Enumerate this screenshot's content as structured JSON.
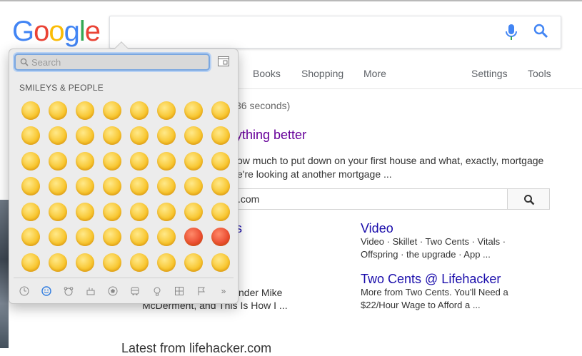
{
  "google": {
    "logo_letters": [
      {
        "ch": "G",
        "color": "#4285F4"
      },
      {
        "ch": "o",
        "color": "#EA4335"
      },
      {
        "ch": "o",
        "color": "#FBBC05"
      },
      {
        "ch": "g",
        "color": "#4285F4"
      },
      {
        "ch": "l",
        "color": "#34A853"
      },
      {
        "ch": "e",
        "color": "#EA4335"
      }
    ],
    "search_value": "",
    "nav": {
      "books": "Books",
      "shopping": "Shopping",
      "more": "More",
      "settings": "Settings",
      "tools": "Tools"
    }
  },
  "results": {
    "stats_tail": "36 seconds)",
    "title_partial": "ything better",
    "snippet_line1": "ow much to put down on your first house and what, exactly, mortgage",
    "snippet_line2": "e're looking at another mortgage ...",
    "site_search_suffix": ".com",
    "left_link_partial": "s",
    "left_text1": "nder Mike",
    "left_text2": "McDerment, and This Is How I ...",
    "video_title": "Video",
    "video_line1": "Video · Skillet · Two Cents · Vitals ·",
    "video_line2": "Offspring · the upgrade · App ...",
    "twocents_title": "Two Cents @ Lifehacker",
    "twocents_line1": "More from Two Cents. You'll Need a",
    "twocents_line2": "$22/Hour Wage to Afford a ...",
    "bottom_partial": "Latest from lifehacker.com"
  },
  "picker": {
    "search_placeholder": "Search",
    "section_title": "SMILEYS & PEOPLE",
    "emoji": [
      "grinning-face",
      "grinning-face-big-eyes",
      "grinning-face-smiling-eyes",
      "beaming-face",
      "grinning-squinting-face",
      "grinning-face-sweat",
      "face-tears-of-joy",
      "rolling-on-floor-laughing",
      "smiling-face",
      "smiling-face-smiling-eyes",
      "smiling-face-halo",
      "slightly-smiling-face",
      "upside-down-face",
      "winking-face",
      "relieved-face",
      "heart-eyes-face",
      "face-blowing-kiss",
      "kissing-face",
      "kissing-face-smiling-eyes",
      "kissing-face-closed-eyes",
      "face-savoring-food",
      "face-with-tongue",
      "squinting-face-tongue",
      "winking-face-tongue",
      "zany-face",
      "face-raised-eyebrow",
      "face-with-monocle",
      "nerd-face",
      "smiling-face-sunglasses",
      "star-struck",
      "smirking-face",
      "unamused-face",
      "disappointed-face",
      "pensive-face",
      "worried-face",
      "confused-face",
      "slightly-frowning-face",
      "frowning-face",
      "persevering-face",
      "confounded-face",
      "tired-face",
      "weary-face",
      "crying-face",
      "loudly-crying-face",
      "face-steam-from-nose",
      "angry-face",
      "pouting-face",
      "face-symbols-on-mouth",
      "exploding-head",
      "flushed-face",
      "face-screaming-in-fear",
      "fearful-face",
      "anxious-face-sweat",
      "sad-relieved-face",
      "downcast-face-sweat",
      "hugging-face"
    ],
    "red_faces": [
      46,
      47
    ],
    "categories": [
      "clock-icon",
      "smiley-icon",
      "bear-icon",
      "food-icon",
      "ball-icon",
      "car-icon",
      "bulb-icon",
      "symbols-icon",
      "flag-icon",
      "more-icon"
    ],
    "more_glyph": "»"
  }
}
